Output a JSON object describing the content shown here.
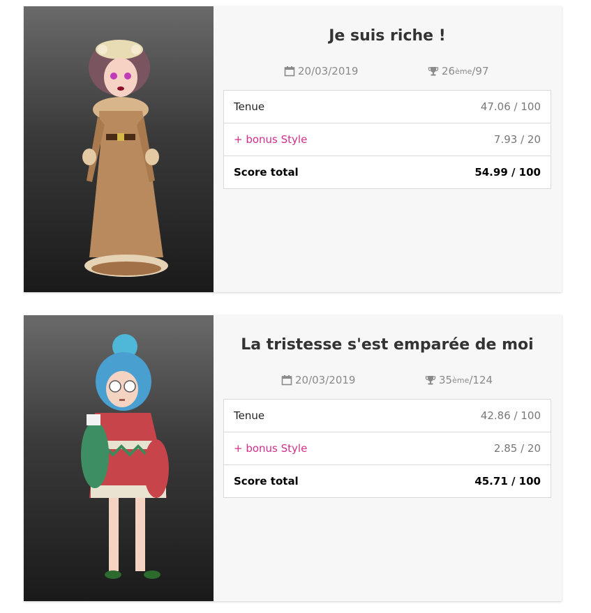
{
  "cards": [
    {
      "title": "Je suis riche !",
      "date": "20/03/2019",
      "rank": "26",
      "rank_suffix": "ème",
      "rank_total": "/97",
      "icons": {
        "date": "calendar-icon",
        "rank": "trophy-icon"
      },
      "rows": [
        {
          "label": "Tenue",
          "value": "47.06 / 100"
        },
        {
          "label": "+ bonus Style",
          "value": "7.93 / 20"
        },
        {
          "label": "Score total",
          "value": "54.99 / 100"
        }
      ]
    },
    {
      "title": "La tristesse s'est emparée de moi",
      "date": "20/03/2019",
      "rank": "35",
      "rank_suffix": "ème",
      "rank_total": "/124",
      "icons": {
        "date": "calendar-icon",
        "rank": "trophy-icon"
      },
      "rows": [
        {
          "label": "Tenue",
          "value": "42.86 / 100"
        },
        {
          "label": "+ bonus Style",
          "value": "2.85 / 20"
        },
        {
          "label": "Score total",
          "value": "45.71 / 100"
        }
      ]
    }
  ],
  "colors": {
    "bonus": "#d12e8a",
    "card_bg": "#f7f7f7",
    "title": "#333333"
  }
}
